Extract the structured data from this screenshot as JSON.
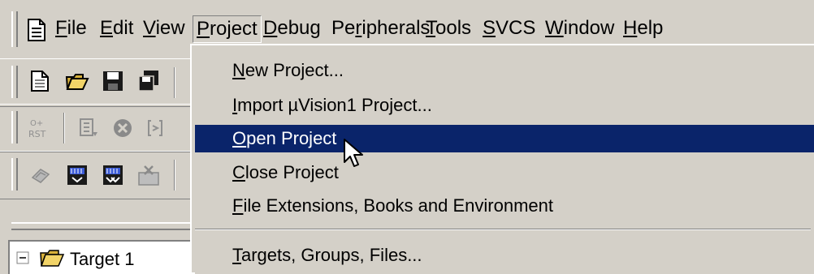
{
  "menubar": {
    "items": [
      {
        "pre": "",
        "key": "F",
        "post": "ile"
      },
      {
        "pre": "",
        "key": "E",
        "post": "dit"
      },
      {
        "pre": "",
        "key": "V",
        "post": "iew"
      },
      {
        "pre": "",
        "key": "P",
        "post": "roject"
      },
      {
        "pre": "",
        "key": "D",
        "post": "ebug"
      },
      {
        "pre": "Pe",
        "key": "r",
        "post": "ipherals"
      },
      {
        "pre": "",
        "key": "T",
        "post": "ools"
      },
      {
        "pre": "",
        "key": "S",
        "post": "VCS"
      },
      {
        "pre": "",
        "key": "W",
        "post": "indow"
      },
      {
        "pre": "",
        "key": "H",
        "post": "elp"
      }
    ],
    "open_menu": "Project"
  },
  "toolbar": {
    "row1": [
      "new-file-icon",
      "open-folder-icon",
      "save-disk-icon",
      "save-all-icon"
    ],
    "row2": [
      "reset-cpu-icon",
      "run-icon",
      "stop-icon",
      "step-icon"
    ],
    "row3": [
      "translate-icon",
      "build-icon",
      "rebuild-icon",
      "stop-build-icon"
    ]
  },
  "project_menu": {
    "items": [
      {
        "pre": "",
        "key": "N",
        "post": "ew Project..."
      },
      {
        "pre": "",
        "key": "I",
        "post": "mport µVision1 Project..."
      },
      {
        "pre": "",
        "key": "O",
        "post": "pen Project",
        "selected": true
      },
      {
        "pre": "",
        "key": "C",
        "post": "lose Project"
      },
      {
        "pre": "",
        "key": "F",
        "post": "ile Extensions, Books and Environment"
      },
      {
        "pre": "",
        "key": "T",
        "post": "argets, Groups, Files..."
      }
    ]
  },
  "project_panel": {
    "tree_root": "Target 1"
  },
  "colors": {
    "face": "#d4d0c8",
    "highlight": "#0a246a",
    "highlight_text": "#ffffff"
  }
}
